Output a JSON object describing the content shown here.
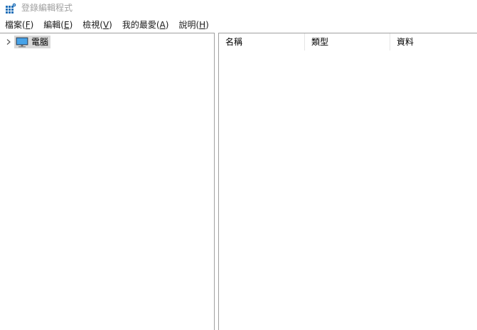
{
  "window": {
    "title": "登錄編輯程式"
  },
  "menu": [
    {
      "label": "檔案(",
      "mnemonic": "F",
      "suffix": ")"
    },
    {
      "label": "編輯(",
      "mnemonic": "E",
      "suffix": ")"
    },
    {
      "label": "檢視(",
      "mnemonic": "V",
      "suffix": ")"
    },
    {
      "label": "我的最愛(",
      "mnemonic": "A",
      "suffix": ")"
    },
    {
      "label": "說明(",
      "mnemonic": "H",
      "suffix": ")"
    }
  ],
  "tree": {
    "root_label": "電腦",
    "root_icon": "computer-icon",
    "expanded": false,
    "selected": true
  },
  "list": {
    "columns": [
      "名稱",
      "類型",
      "資料"
    ],
    "rows": []
  },
  "colors": {
    "title_text": "#a0a0a0",
    "selection": "#d9d9d9",
    "border": "#a0a0a0",
    "icon_blue": "#1e6fb8"
  }
}
